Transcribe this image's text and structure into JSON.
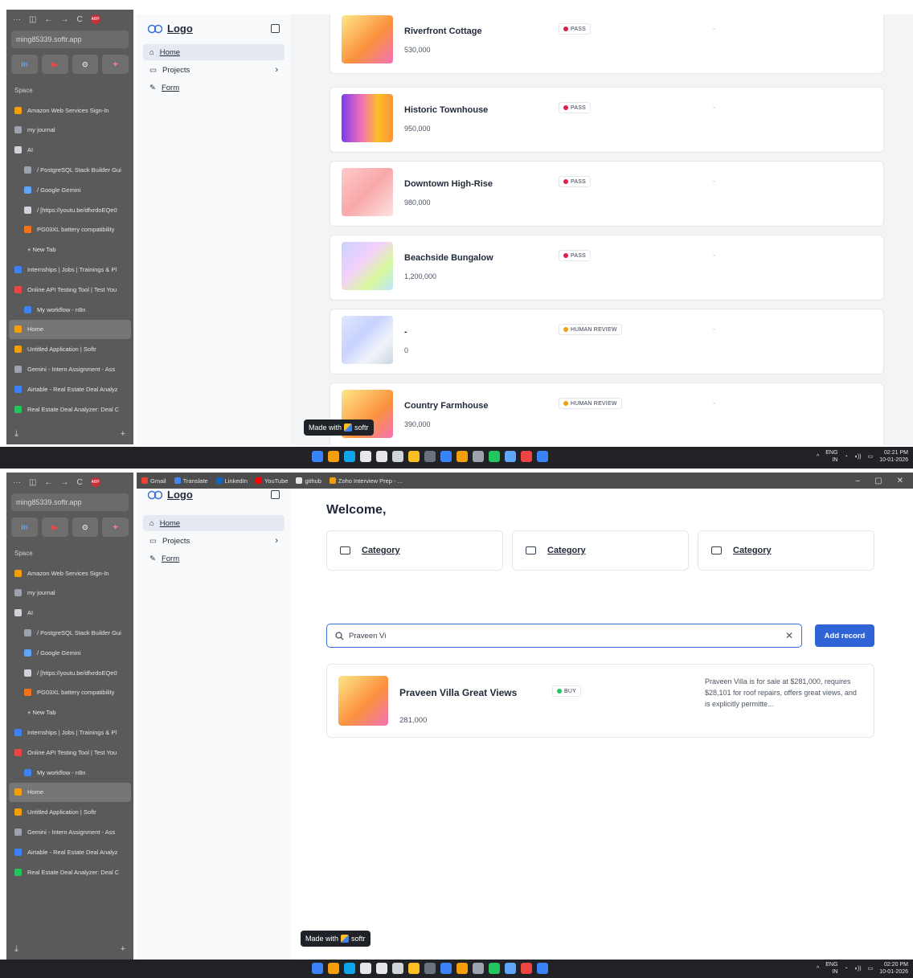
{
  "browser": {
    "url": "ming85339.softr.app",
    "favorites": [
      "in",
      "▶",
      "⊙",
      "✦"
    ],
    "space_label": "Space",
    "items_shot1": [
      {
        "label": "Amazon Web Services Sign-In",
        "color": "#f59e0b",
        "sub": false,
        "active": false
      },
      {
        "label": "my journal",
        "color": "#9ca3af",
        "sub": false,
        "active": false
      },
      {
        "label": "AI",
        "color": "#d1d5db",
        "sub": false,
        "active": false
      },
      {
        "label": "/ PostgreSQL Stack Builder Gui",
        "color": "#9ca3af",
        "sub": true,
        "active": false
      },
      {
        "label": "/ Google Gemini",
        "color": "#60a5fa",
        "sub": true,
        "active": false
      },
      {
        "label": "/ [https://youtu.be/dfxrdoEQe0",
        "color": "#d1d5db",
        "sub": true,
        "active": false
      },
      {
        "label": "PG03XL battery compatibility",
        "color": "#f97316",
        "sub": true,
        "active": false
      },
      {
        "label": "+ New Tab",
        "color": "transparent",
        "sub": false,
        "active": false
      },
      {
        "label": "Internships | Jobs | Trainings & Pl",
        "color": "#3b82f6",
        "sub": false,
        "active": false
      },
      {
        "label": "Online API Testing Tool | Test You",
        "color": "#ef4444",
        "sub": false,
        "active": false
      },
      {
        "label": "My workflow - n8n",
        "color": "#3b82f6",
        "sub": true,
        "active": false
      },
      {
        "label": "Home",
        "color": "#f59e0b",
        "sub": false,
        "active": true
      },
      {
        "label": "Untitled Application | Softr",
        "color": "#f59e0b",
        "sub": false,
        "active": false
      },
      {
        "label": "Gemini - Intern Assignment - Ass",
        "color": "#9ca3af",
        "sub": false,
        "active": false
      },
      {
        "label": "Airtable - Real Estate Deal Analyz",
        "color": "#3b82f6",
        "sub": false,
        "active": false
      },
      {
        "label": "Real Estate Deal Analyzer: Deal C",
        "color": "#22c55e",
        "sub": false,
        "active": false
      }
    ]
  },
  "bookmarks": [
    {
      "label": "Gmail",
      "color": "#ea4335"
    },
    {
      "label": "Translate",
      "color": "#4285f4"
    },
    {
      "label": "LinkedIn",
      "color": "#0a66c2"
    },
    {
      "label": "YouTube",
      "color": "#ff0000"
    },
    {
      "label": "github",
      "color": "#e5e5e5"
    },
    {
      "label": "Zoho Interview Prep - ...",
      "color": "#f59e0b"
    }
  ],
  "app": {
    "logo": "Logo",
    "nav": [
      {
        "label": "Home",
        "icon": "home-icon",
        "active": true,
        "link": true
      },
      {
        "label": "Projects",
        "icon": "folder-icon",
        "active": false,
        "link": false,
        "chevron": "›"
      },
      {
        "label": "Form",
        "icon": "pen-icon",
        "active": false,
        "link": true
      }
    ],
    "made_with": "Made with",
    "softr": "softr"
  },
  "listing": [
    {
      "title": "Riverfront Cottage",
      "price": "530,000",
      "badge": "PASS",
      "badge_color": "#e11d48",
      "extra": "-",
      "gradient": "g1"
    },
    {
      "title": "Historic Townhouse",
      "price": "950,000",
      "badge": "PASS",
      "badge_color": "#e11d48",
      "extra": "-",
      "gradient": "g2"
    },
    {
      "title": "Downtown High-Rise",
      "price": "980,000",
      "badge": "PASS",
      "badge_color": "#e11d48",
      "extra": "-",
      "gradient": "g3"
    },
    {
      "title": "Beachside Bungalow",
      "price": "1,200,000",
      "badge": "PASS",
      "badge_color": "#e11d48",
      "extra": "-",
      "gradient": "g4"
    },
    {
      "title": "-",
      "price": "0",
      "badge": "HUMAN REVIEW",
      "badge_color": "#f59e0b",
      "extra": "-",
      "gradient": "g5"
    },
    {
      "title": "Country Farmhouse",
      "price": "390,000",
      "badge": "HUMAN REVIEW",
      "badge_color": "#f59e0b",
      "extra": "-",
      "gradient": "g6"
    }
  ],
  "home": {
    "welcome": "Welcome,",
    "categories": [
      "Category",
      "Category",
      "Category"
    ],
    "search_value": "Praveen Vi",
    "add_record": "Add record",
    "result": {
      "title": "Praveen Villa Great Views",
      "price": "281,000",
      "badge": "BUY",
      "badge_color": "#22c55e",
      "description": "Praveen Villa is for sale at $281,000, requires $28,101 for roof repairs, offers great views, and is explicitly permitte..."
    }
  },
  "taskbar": {
    "lang": "ENG",
    "region": "IN",
    "time1": "02:21 PM",
    "time2": "02:20 PM",
    "date": "10-01-2026",
    "app_colors": [
      "#3b82f6",
      "#f59e0b",
      "#0ea5e9",
      "#e5e7eb",
      "#e5e7eb",
      "#d1d5db",
      "#fbbf24",
      "#6b7280",
      "#3b82f6",
      "#f59e0b",
      "#9ca3af",
      "#22c55e",
      "#60a5fa",
      "#ef4444",
      "#3b82f6"
    ]
  }
}
